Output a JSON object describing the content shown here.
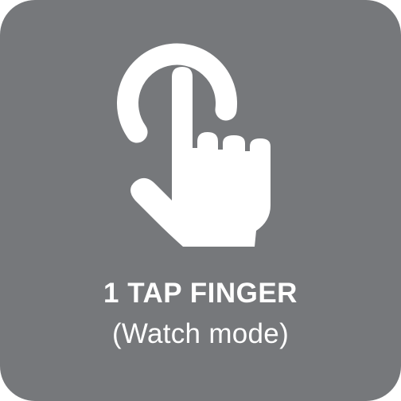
{
  "tile": {
    "title": "1 TAP FINGER",
    "subtitle": "(Watch mode)",
    "icon": "tap-hand-icon",
    "colors": {
      "background": "#76787b",
      "foreground": "#ffffff"
    }
  }
}
